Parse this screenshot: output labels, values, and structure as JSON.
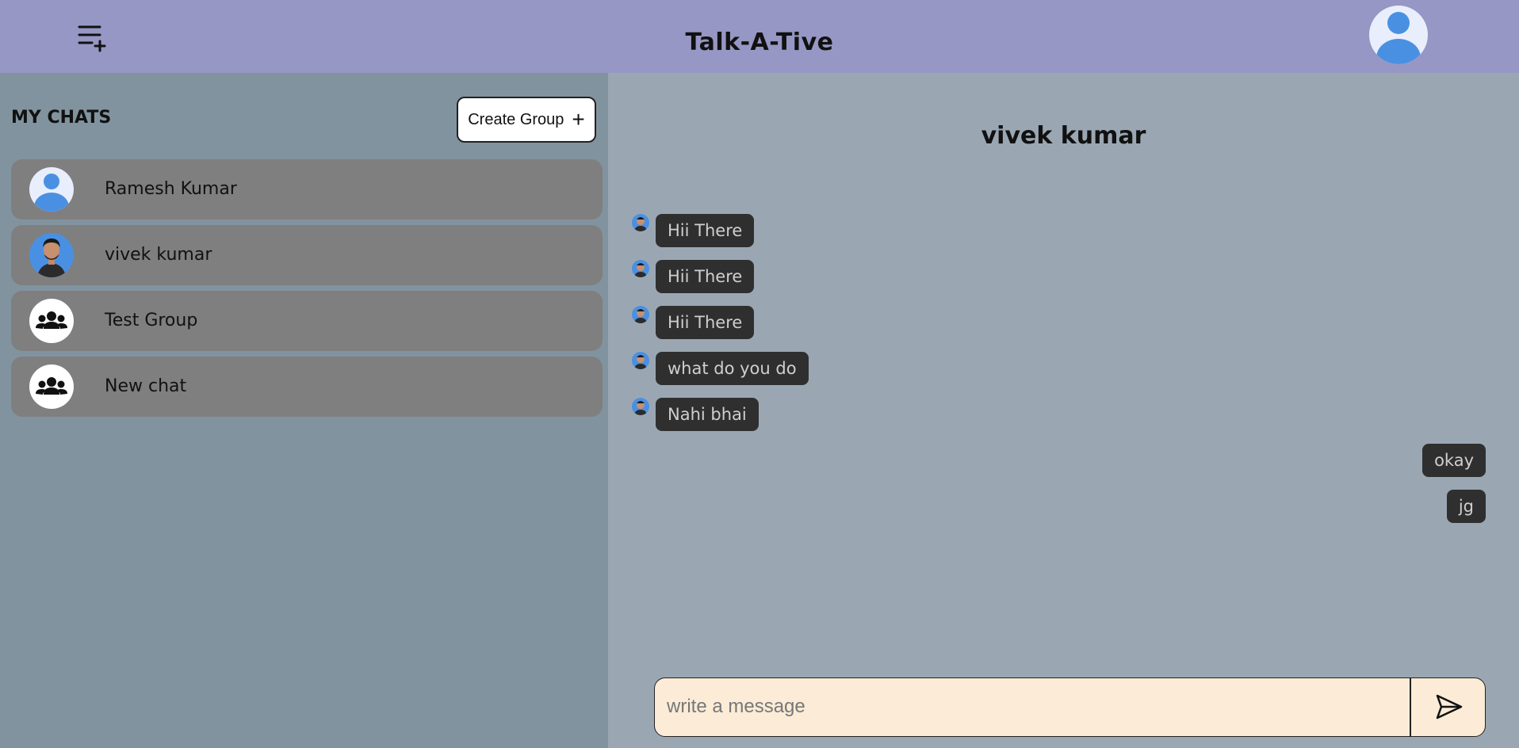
{
  "header": {
    "title": "Talk-A-Tive",
    "menu_icon": "add-list-icon",
    "profile_icon": "user-avatar-icon"
  },
  "sidebar": {
    "title": "MY CHATS",
    "create_group_label": "Create Group",
    "create_group_icon": "plus-icon",
    "chats": [
      {
        "name": "Ramesh Kumar",
        "avatar": "default-user-icon"
      },
      {
        "name": "vivek kumar",
        "avatar": "user-photo"
      },
      {
        "name": "Test Group",
        "avatar": "group-icon"
      },
      {
        "name": "New chat",
        "avatar": "group-icon"
      }
    ]
  },
  "chat": {
    "title": "vivek kumar",
    "messages": [
      {
        "text": "Hii There",
        "from": "other"
      },
      {
        "text": "Hii There",
        "from": "other"
      },
      {
        "text": "Hii There",
        "from": "other"
      },
      {
        "text": "what do you do",
        "from": "other"
      },
      {
        "text": "Nahi bhai",
        "from": "other"
      },
      {
        "text": "okay",
        "from": "self"
      },
      {
        "text": "jg",
        "from": "self"
      }
    ]
  },
  "composer": {
    "placeholder": "write a message",
    "value": "",
    "send_icon": "send-icon"
  },
  "colors": {
    "header_bg": "#9697c4",
    "sidebar_bg": "#81939e",
    "main_bg": "#9aa7b3",
    "chat_item_bg": "#7f7f7f",
    "bubble_bg": "#2f2f2f",
    "composer_bg": "#fbebd7",
    "avatar_blue": "#4a90e2"
  }
}
